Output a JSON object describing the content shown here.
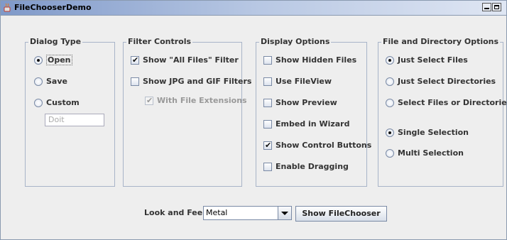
{
  "window": {
    "title": "FileChooserDemo"
  },
  "groups": {
    "dialog_type": {
      "legend": "Dialog Type",
      "open": "Open",
      "save": "Save",
      "custom": "Custom",
      "custom_field_placeholder": "Doit"
    },
    "filter_controls": {
      "legend": "Filter Controls",
      "show_all_files": "Show \"All Files\" Filter",
      "show_jpg_gif": "Show JPG and GIF Filters",
      "with_file_extensions": "With File Extensions"
    },
    "display_options": {
      "legend": "Display Options",
      "show_hidden": "Show Hidden Files",
      "use_fileview": "Use FileView",
      "show_preview": "Show Preview",
      "embed_wizard": "Embed in Wizard",
      "show_control_buttons": "Show Control Buttons",
      "enable_dragging": "Enable Dragging"
    },
    "file_dir_options": {
      "legend": "File and Directory Options",
      "just_files": "Just Select Files",
      "just_dirs": "Just Select Directories",
      "files_or_dirs": "Select Files or Directories",
      "single": "Single Selection",
      "multi": "Multi Selection"
    }
  },
  "bottom": {
    "laf_label": "Look and Feel:",
    "laf_value": "Metal",
    "show_button": "Show FileChooser"
  },
  "icons": {
    "app": "java-cup-icon",
    "minimize": "minimize-icon",
    "maximize": "maximize-icon",
    "dropdown": "chevron-down-icon"
  }
}
